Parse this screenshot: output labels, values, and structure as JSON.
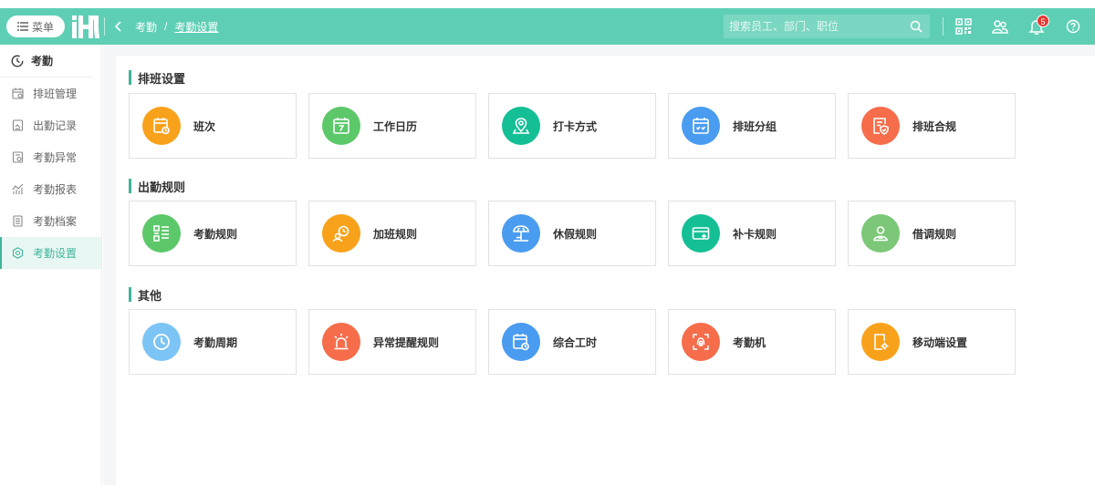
{
  "header": {
    "menu_label": "菜单",
    "breadcrumb": {
      "parent": "考勤",
      "separator": "/",
      "current": "考勤设置"
    },
    "search_placeholder": "搜索员工、部门、职位",
    "notification_count": "5"
  },
  "sidebar": {
    "title": "考勤",
    "items": [
      {
        "label": "排班管理",
        "icon": "schedule-icon"
      },
      {
        "label": "出勤记录",
        "icon": "record-icon"
      },
      {
        "label": "考勤异常",
        "icon": "abnormal-icon"
      },
      {
        "label": "考勤报表",
        "icon": "report-icon"
      },
      {
        "label": "考勤档案",
        "icon": "archive-icon"
      },
      {
        "label": "考勤设置",
        "icon": "settings-icon",
        "active": true
      }
    ]
  },
  "sections": [
    {
      "title": "排班设置",
      "cards": [
        {
          "label": "班次",
          "icon": "shift-icon",
          "color": "#f8a21c"
        },
        {
          "label": "工作日历",
          "icon": "calendar-icon",
          "color": "#5cc86a"
        },
        {
          "label": "打卡方式",
          "icon": "location-icon",
          "color": "#15bf96"
        },
        {
          "label": "排班分组",
          "icon": "group-calendar-icon",
          "color": "#4a9cf0"
        },
        {
          "label": "排班合规",
          "icon": "compliance-icon",
          "color": "#f66d4b"
        }
      ]
    },
    {
      "title": "出勤规则",
      "cards": [
        {
          "label": "考勤规则",
          "icon": "rules-list-icon",
          "color": "#5cc86a"
        },
        {
          "label": "加班规则",
          "icon": "overtime-icon",
          "color": "#f8a21c"
        },
        {
          "label": "休假规则",
          "icon": "vacation-icon",
          "color": "#4a9cf0"
        },
        {
          "label": "补卡规则",
          "icon": "card-icon",
          "color": "#15bf96"
        },
        {
          "label": "借调规则",
          "icon": "transfer-person-icon",
          "color": "#7cc878"
        }
      ]
    },
    {
      "title": "其他",
      "cards": [
        {
          "label": "考勤周期",
          "icon": "clock-icon",
          "color": "#7cc4f5"
        },
        {
          "label": "异常提醒规则",
          "icon": "alarm-icon",
          "color": "#f66d4b"
        },
        {
          "label": "综合工时",
          "icon": "work-hours-icon",
          "color": "#4a9cf0"
        },
        {
          "label": "考勤机",
          "icon": "fingerprint-icon",
          "color": "#f66d4b"
        },
        {
          "label": "移动端设置",
          "icon": "mobile-settings-icon",
          "color": "#f8a21c"
        }
      ]
    }
  ]
}
